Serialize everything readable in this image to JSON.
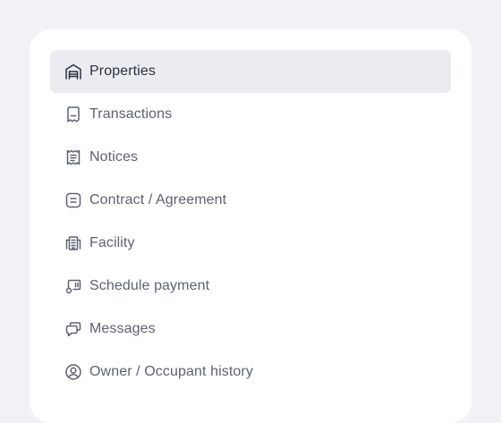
{
  "menu": {
    "items": [
      {
        "label": "Properties",
        "icon": "warehouse-icon",
        "active": true
      },
      {
        "label": "Transactions",
        "icon": "receipt-icon",
        "active": false
      },
      {
        "label": "Notices",
        "icon": "notice-receipt-icon",
        "active": false
      },
      {
        "label": "Contract / Agreement",
        "icon": "document-lines-icon",
        "active": false
      },
      {
        "label": "Facility",
        "icon": "building-icon",
        "active": false
      },
      {
        "label": "Schedule payment",
        "icon": "payment-card-icon",
        "active": false
      },
      {
        "label": "Messages",
        "icon": "chat-bubbles-icon",
        "active": false
      },
      {
        "label": "Owner / Occupant history",
        "icon": "user-circle-icon",
        "active": false
      }
    ]
  },
  "colors": {
    "page_background": "#f0f2f6",
    "card_background": "#ffffff",
    "active_background": "#ebecef",
    "icon_color": "#5c6270",
    "active_icon_color": "#2a3040"
  }
}
